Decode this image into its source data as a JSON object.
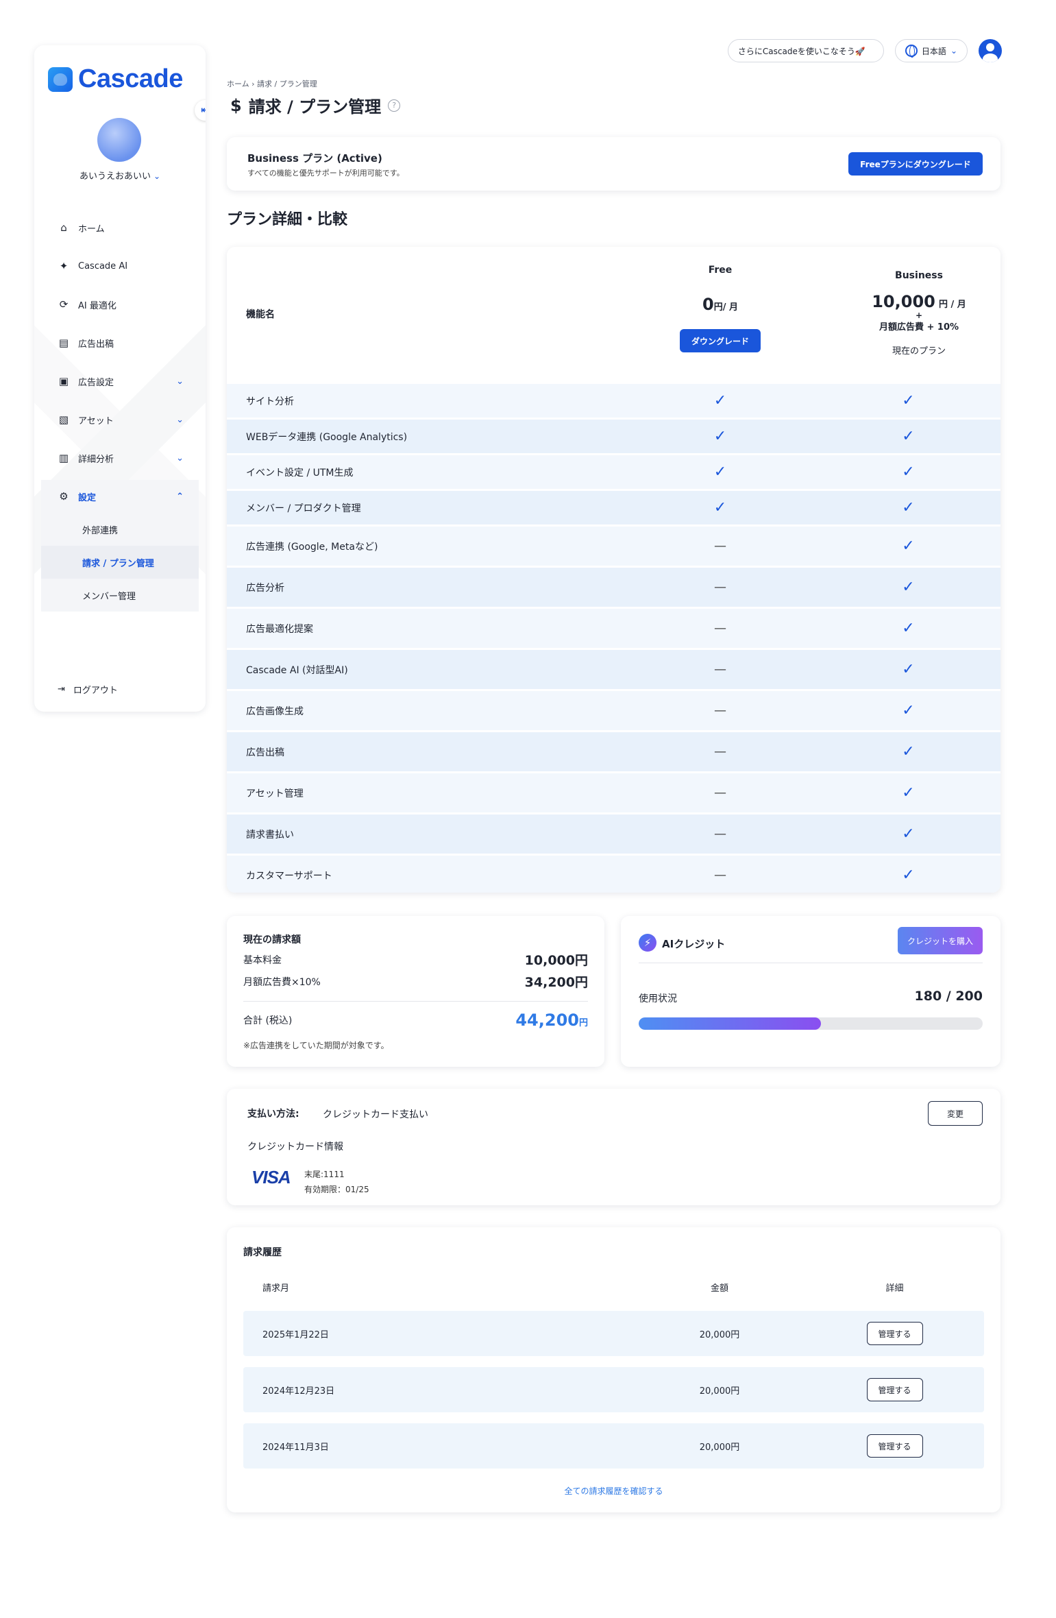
{
  "app": {
    "brand": "Cascade"
  },
  "topbar": {
    "promo": "さらにCascadeを使いこなそう🚀",
    "language": "日本語"
  },
  "sidebar": {
    "user_name": "あいうえおあいい",
    "items": [
      {
        "label": "ホーム",
        "icon": "home-icon"
      },
      {
        "label": "Cascade AI",
        "icon": "sparkle-icon"
      },
      {
        "label": "AI 最適化",
        "icon": "ai-optimize-icon"
      },
      {
        "label": "広告出稿",
        "icon": "ad-post-icon"
      },
      {
        "label": "広告設定",
        "icon": "ad-settings-icon"
      },
      {
        "label": "アセット",
        "icon": "image-icon"
      },
      {
        "label": "詳細分析",
        "icon": "chart-icon"
      },
      {
        "label": "設定",
        "icon": "gear-icon"
      }
    ],
    "sub_items": [
      "外部連携",
      "請求 / プラン管理",
      "メンバー管理"
    ],
    "logout": "ログアウト"
  },
  "header": {
    "breadcrumb": "ホーム  ›  請求 / プラン管理",
    "title": "請求 / プラン管理"
  },
  "plan_banner": {
    "title": "Business プラン (Active)",
    "subtitle": "すべての機能と優先サポートが利用可能です。",
    "button": "Freeプランにダウングレード"
  },
  "comparison": {
    "section_title": "プラン詳細・比較",
    "feature_header": "機能名",
    "free": {
      "name": "Free",
      "price": "0",
      "unit": "円/ 月",
      "button": "ダウングレード"
    },
    "business": {
      "name": "Business",
      "price": "10,000",
      "unit": "円 / 月",
      "plus": "+",
      "extra": "月額広告費 + 10%",
      "current": "現在のプラン"
    },
    "features": [
      {
        "name": "サイト分析",
        "free": true,
        "business": true
      },
      {
        "name": "WEBデータ連携 (Google Analytics)",
        "free": true,
        "business": true
      },
      {
        "name": "イベント設定 / UTM生成",
        "free": true,
        "business": true
      },
      {
        "name": "メンバー / プロダクト管理",
        "free": true,
        "business": true
      },
      {
        "name": "広告連携 (Google, Metaなど)",
        "free": false,
        "business": true
      },
      {
        "name": "広告分析",
        "free": false,
        "business": true
      },
      {
        "name": "広告最適化提案",
        "free": false,
        "business": true
      },
      {
        "name": "Cascade AI (対話型AI)",
        "free": false,
        "business": true
      },
      {
        "name": "広告画像生成",
        "free": false,
        "business": true
      },
      {
        "name": "広告出稿",
        "free": false,
        "business": true
      },
      {
        "name": "アセット管理",
        "free": false,
        "business": true
      },
      {
        "name": "請求書払い",
        "free": false,
        "business": true
      },
      {
        "name": "カスタマーサポート",
        "free": false,
        "business": true
      }
    ],
    "check_symbol": "✓",
    "dash_symbol": "—"
  },
  "billing": {
    "title": "現在の請求額",
    "base_label": "基本料金",
    "base_value": "10,000円",
    "ad_label": "月額広告費×10%",
    "ad_value": "34,200円",
    "total_label": "合計 (税込)",
    "total_value": "44,200",
    "total_unit": "円",
    "note": "※広告連携をしていた期間が対象です。"
  },
  "credit": {
    "title": "AIクレジット",
    "buy_button": "クレジットを購入",
    "usage_label": "使用状況",
    "usage_value": "180 / 200",
    "usage_fraction": 0.53
  },
  "payment": {
    "label": "支払い方法:",
    "method": "クレジットカード支払い",
    "change_button": "変更",
    "card_info_label": "クレジットカード情報",
    "brand": "VISA",
    "last4": "末尾:1111",
    "expiry": "有効期限：01/25"
  },
  "history": {
    "title": "請求履歴",
    "columns": [
      "請求月",
      "金額",
      "詳細"
    ],
    "rows": [
      {
        "date": "2025年1月22日",
        "amount": "20,000円",
        "action": "管理する"
      },
      {
        "date": "2024年12月23日",
        "amount": "20,000円",
        "action": "管理する"
      },
      {
        "date": "2024年11月3日",
        "amount": "20,000円",
        "action": "管理する"
      }
    ],
    "all_link": "全ての請求履歴を確認する"
  },
  "colors": {
    "accent": "#1a56db",
    "row_light": "#f2f7fd",
    "row_dark": "#e8f1fb"
  }
}
